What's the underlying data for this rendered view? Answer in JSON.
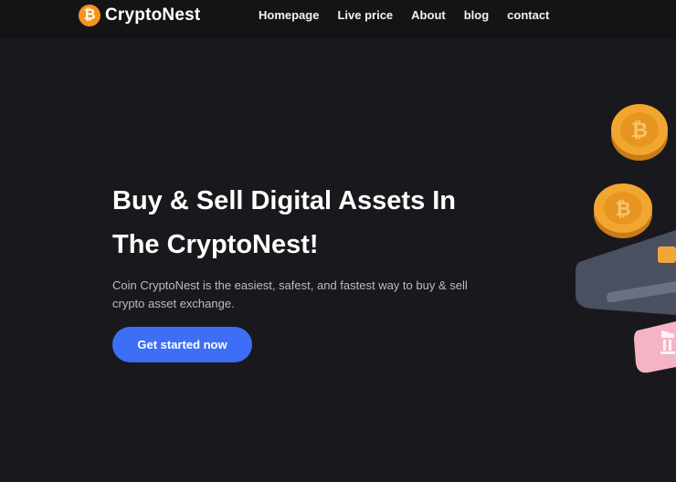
{
  "brand": {
    "name": "CryptoNest",
    "logo_glyph": "₿",
    "logo_icon": "bitcoin-icon",
    "logo_color": "#f7931a"
  },
  "nav": {
    "items": [
      "Homepage",
      "Live price",
      "About",
      "blog",
      "contact"
    ]
  },
  "hero": {
    "title_line1": "Buy & Sell Digital Assets In",
    "title_line2": "The CryptoNest!",
    "desc_line1": "Coin CryptoNest is the easiest, safest, and fastest way to buy & sell",
    "desc_line2": "crypto asset exchange.",
    "cta_label": "Get started now"
  },
  "colors": {
    "background": "#19191d",
    "nav_background": "#141417",
    "accent": "#3c6ef6",
    "coin": "#f0a030"
  },
  "illustration": {
    "icons": [
      "bitcoin-coin-icon",
      "bitcoin-coin-icon",
      "credit-card-icon",
      "bank-icon"
    ]
  }
}
